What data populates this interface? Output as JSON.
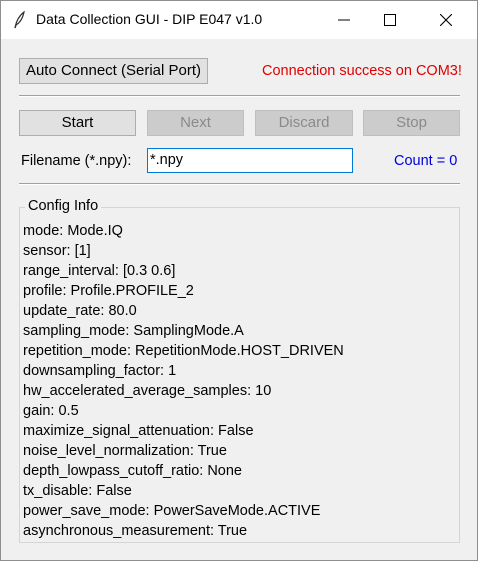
{
  "window": {
    "title": "Data Collection GUI - DIP E047 v1.0",
    "icon": "feather-icon",
    "controls": [
      "minimize-icon",
      "maximize-icon",
      "close-icon"
    ]
  },
  "connect": {
    "button_label": "Auto Connect (Serial Port)",
    "status_text": "Connection success on COM3!",
    "status_color": "#e00000"
  },
  "controls": {
    "start_label": "Start",
    "next_label": "Next",
    "discard_label": "Discard",
    "stop_label": "Stop"
  },
  "filename": {
    "label": "Filename (*.npy):",
    "value": "*.npy",
    "count_text": "Count = 0",
    "count_color": "#0000dd"
  },
  "config": {
    "title": "Config Info",
    "lines": [
      "mode: Mode.IQ",
      "sensor: [1]",
      "range_interval: [0.3 0.6]",
      "profile: Profile.PROFILE_2",
      "update_rate: 80.0",
      "sampling_mode: SamplingMode.A",
      "repetition_mode: RepetitionMode.HOST_DRIVEN",
      "downsampling_factor: 1",
      "hw_accelerated_average_samples: 10",
      "gain: 0.5",
      "maximize_signal_attenuation: False",
      "noise_level_normalization: True",
      "depth_lowpass_cutoff_ratio: None",
      "tx_disable: False",
      "power_save_mode: PowerSaveMode.ACTIVE",
      "asynchronous_measurement: True"
    ]
  }
}
